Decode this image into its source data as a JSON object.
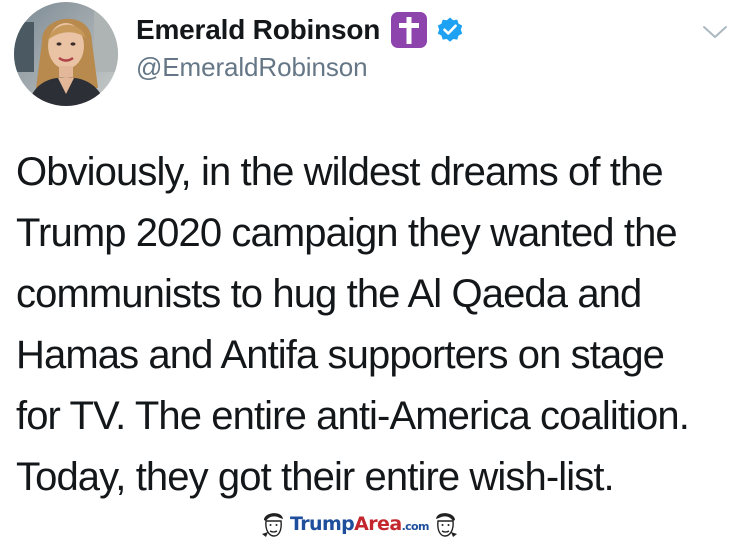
{
  "author": {
    "display_name": "Emerald Robinson",
    "handle": "@EmeraldRobinson",
    "badges": [
      "latin-cross-emoji",
      "verified-icon"
    ]
  },
  "tweet": {
    "lines": [
      "Obviously, in the wildest dreams of the",
      "Trump 2020 campaign they wanted the",
      "communists to hug the Al Qaeda and",
      "Hamas and Antifa supporters on stage",
      "for TV. The entire anti-America coalition.",
      "Today, they got their entire wish-list."
    ]
  },
  "watermark": {
    "part1": "Trump",
    "part2": "Area",
    "part3": ".com"
  },
  "colors": {
    "text": "#14171a",
    "handle": "#657786",
    "verified": "#1da1f2",
    "cross_bg": "#8e44ad",
    "watermark_blue": "#1e4e9c",
    "watermark_red": "#c4262e"
  },
  "icons": {
    "caret": "chevron-down-icon",
    "verified": "verified-badge-icon",
    "cross": "latin-cross-emoji"
  }
}
